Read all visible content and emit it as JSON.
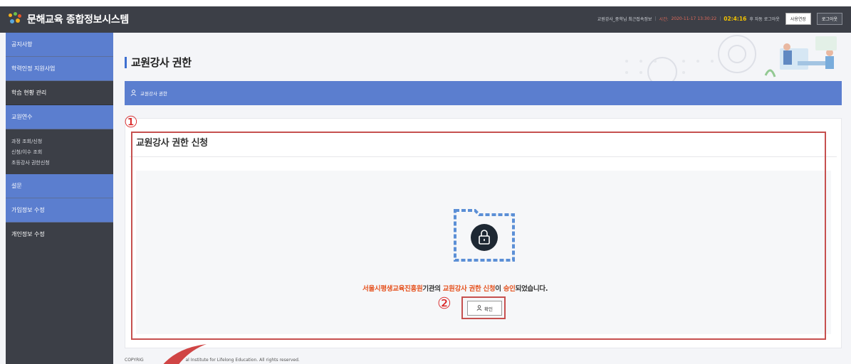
{
  "app": {
    "title": "문해교육 종합정보시스템"
  },
  "header": {
    "user_info": "교원강사_중학님 최근접속정보",
    "time_label": "시간:",
    "time_value": "2020-11-17 13:30:22",
    "remain": "02:4:16",
    "auto_logout": "후 자동 로그아웃",
    "extend_button": "사용연장",
    "logout_button": "로그아웃"
  },
  "sidebar": {
    "items": [
      {
        "label": "공지사항"
      },
      {
        "label": "학력인정 지원사업"
      },
      {
        "label": "학습 현황 관리"
      },
      {
        "label": "교원연수"
      }
    ],
    "sub_items": [
      {
        "label": "과정 조회/신청"
      },
      {
        "label": "신청/이수 조회"
      },
      {
        "label": "초등강사 권한신청"
      }
    ],
    "items2": [
      {
        "label": "설문"
      },
      {
        "label": "가입정보 수정"
      },
      {
        "label": "개인정보 수정"
      }
    ]
  },
  "main": {
    "page_title": "교원강사 권한",
    "breadcrumb": "교원강사 권한",
    "section_title": "교원강사 권한 신청",
    "message": {
      "org": "서울시평생교육진흥원",
      "part1": "기관의 ",
      "request": "교원강사 권한 신청",
      "part2": "이 ",
      "approved": "승인",
      "part3": "되었습니다."
    },
    "confirm_button": "확인"
  },
  "annotations": {
    "marker1": "①",
    "marker2": "②"
  },
  "footer": {
    "left": "COPYRIG",
    "right": "al Institute for Lifelong Education. All rights reserved."
  },
  "colors": {
    "header_bg": "#3c3f47",
    "accent_blue": "#5b7ecf",
    "highlight_orange": "#e5521f",
    "annotation_red": "#c6504f"
  }
}
